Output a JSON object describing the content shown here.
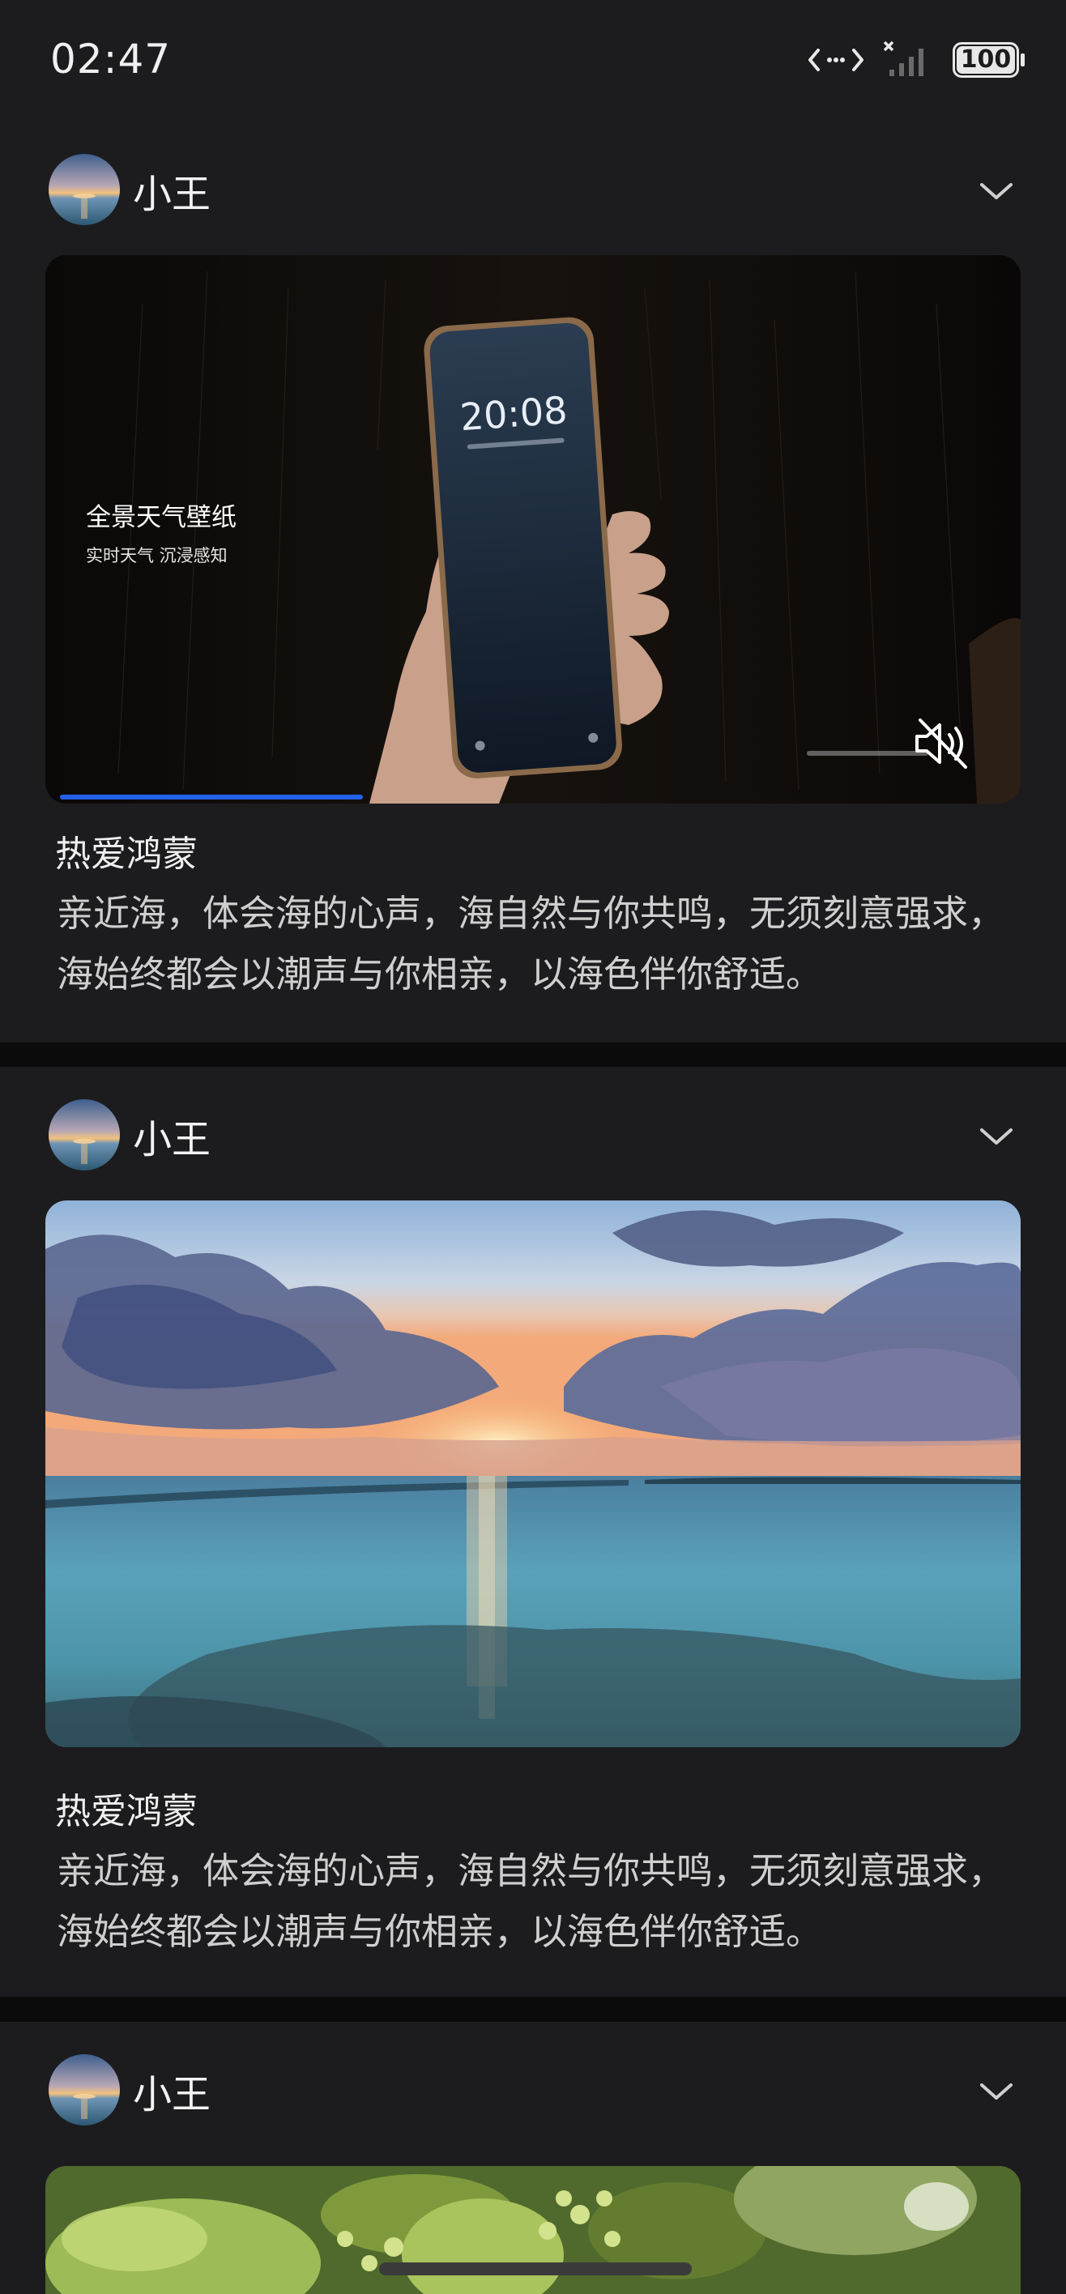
{
  "status_bar": {
    "time": "02:47",
    "battery": "100"
  },
  "posts": [
    {
      "author": "小王",
      "media_type": "video",
      "video": {
        "screen_time": "20:08",
        "caption_title": "全景天气壁纸",
        "caption_subtitle": "实时天气 沉浸感知",
        "progress": 0.32,
        "muted": true
      },
      "title": "热爱鸿蒙",
      "body": "亲近海，体会海的心声，海自然与你共鸣，无须刻意强求，海始终都会以潮声与你相亲，以海色伴你舒适。"
    },
    {
      "author": "小王",
      "media_type": "image",
      "image_subject": "sunset over sea",
      "title": "热爱鸿蒙",
      "body": "亲近海，体会海的心声，海自然与你共鸣，无须刻意强求，海始终都会以潮声与你相亲，以海色伴你舒适。"
    },
    {
      "author": "小王",
      "media_type": "image",
      "image_subject": "green leaves"
    }
  ],
  "colors": {
    "accent": "#2461ea",
    "card_bg": "#1c1c1e",
    "page_bg": "#0b0b0b"
  },
  "icons": [
    "data-transfer-icon",
    "no-signal-icon",
    "battery-icon",
    "chevron-down-icon",
    "mute-icon"
  ]
}
